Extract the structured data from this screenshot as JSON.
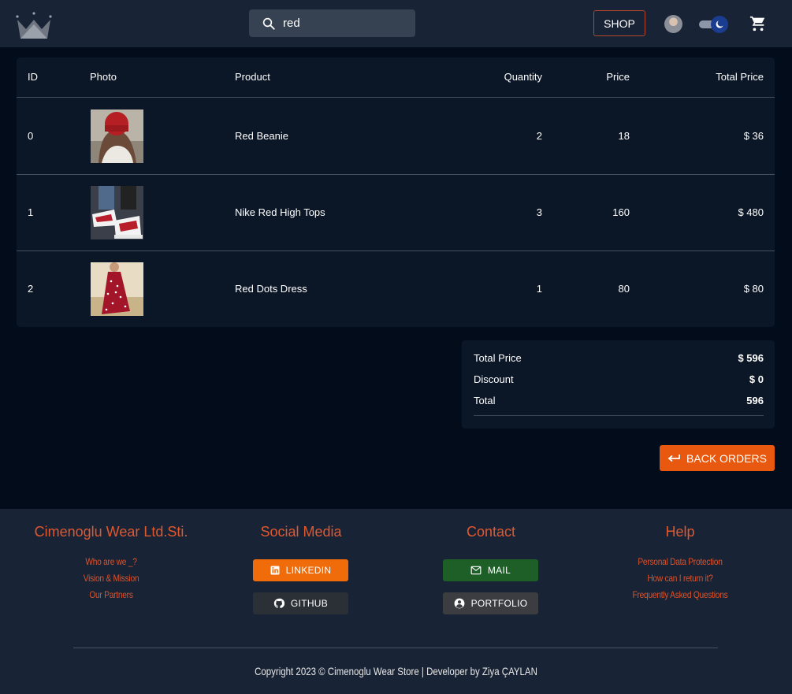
{
  "header": {
    "search_value": "red",
    "shop_label": "SHOP"
  },
  "table": {
    "headers": [
      "ID",
      "Photo",
      "Product",
      "Quantity",
      "Price",
      "Total Price"
    ],
    "rows": [
      {
        "id": "0",
        "product": "Red Beanie",
        "quantity": "2",
        "price": "18",
        "total": "$ 36",
        "photo": "red-beanie-photo"
      },
      {
        "id": "1",
        "product": "Nike Red High Tops",
        "quantity": "3",
        "price": "160",
        "total": "$ 480",
        "photo": "red-sneakers-photo"
      },
      {
        "id": "2",
        "product": "Red Dots Dress",
        "quantity": "1",
        "price": "80",
        "total": "$ 80",
        "photo": "red-dress-photo"
      }
    ]
  },
  "summary": {
    "total_price_label": "Total Price",
    "total_price_value": "$ 596",
    "discount_label": "Discount",
    "discount_value": "$ 0",
    "total_label": "Total",
    "total_value": "596"
  },
  "back_orders_label": "BACK ORDERS",
  "footer": {
    "company": {
      "title": "Cimenoglu Wear Ltd.Sti.",
      "links": [
        "Who are we _?",
        "Vision & Mission",
        "Our Partners"
      ]
    },
    "social": {
      "title": "Social Media",
      "linkedin": "LINKEDIN",
      "github": "GITHUB"
    },
    "contact": {
      "title": "Contact",
      "mail": "MAIL",
      "portfolio": "PORTFOLIO"
    },
    "help": {
      "title": "Help",
      "links": [
        "Personal Data Protection",
        "How can I return it?",
        "Frequently Asked Questions"
      ]
    },
    "copyright": "Copyright 2023 © Cimenoglu Wear Store | Developer by Ziya ÇAYLAN"
  },
  "colors": {
    "accent": "#e8580f",
    "linkedin": "#f06b0a",
    "github": "#2b3036",
    "mail": "#1e5f28",
    "portfolio": "#3b3d40"
  }
}
